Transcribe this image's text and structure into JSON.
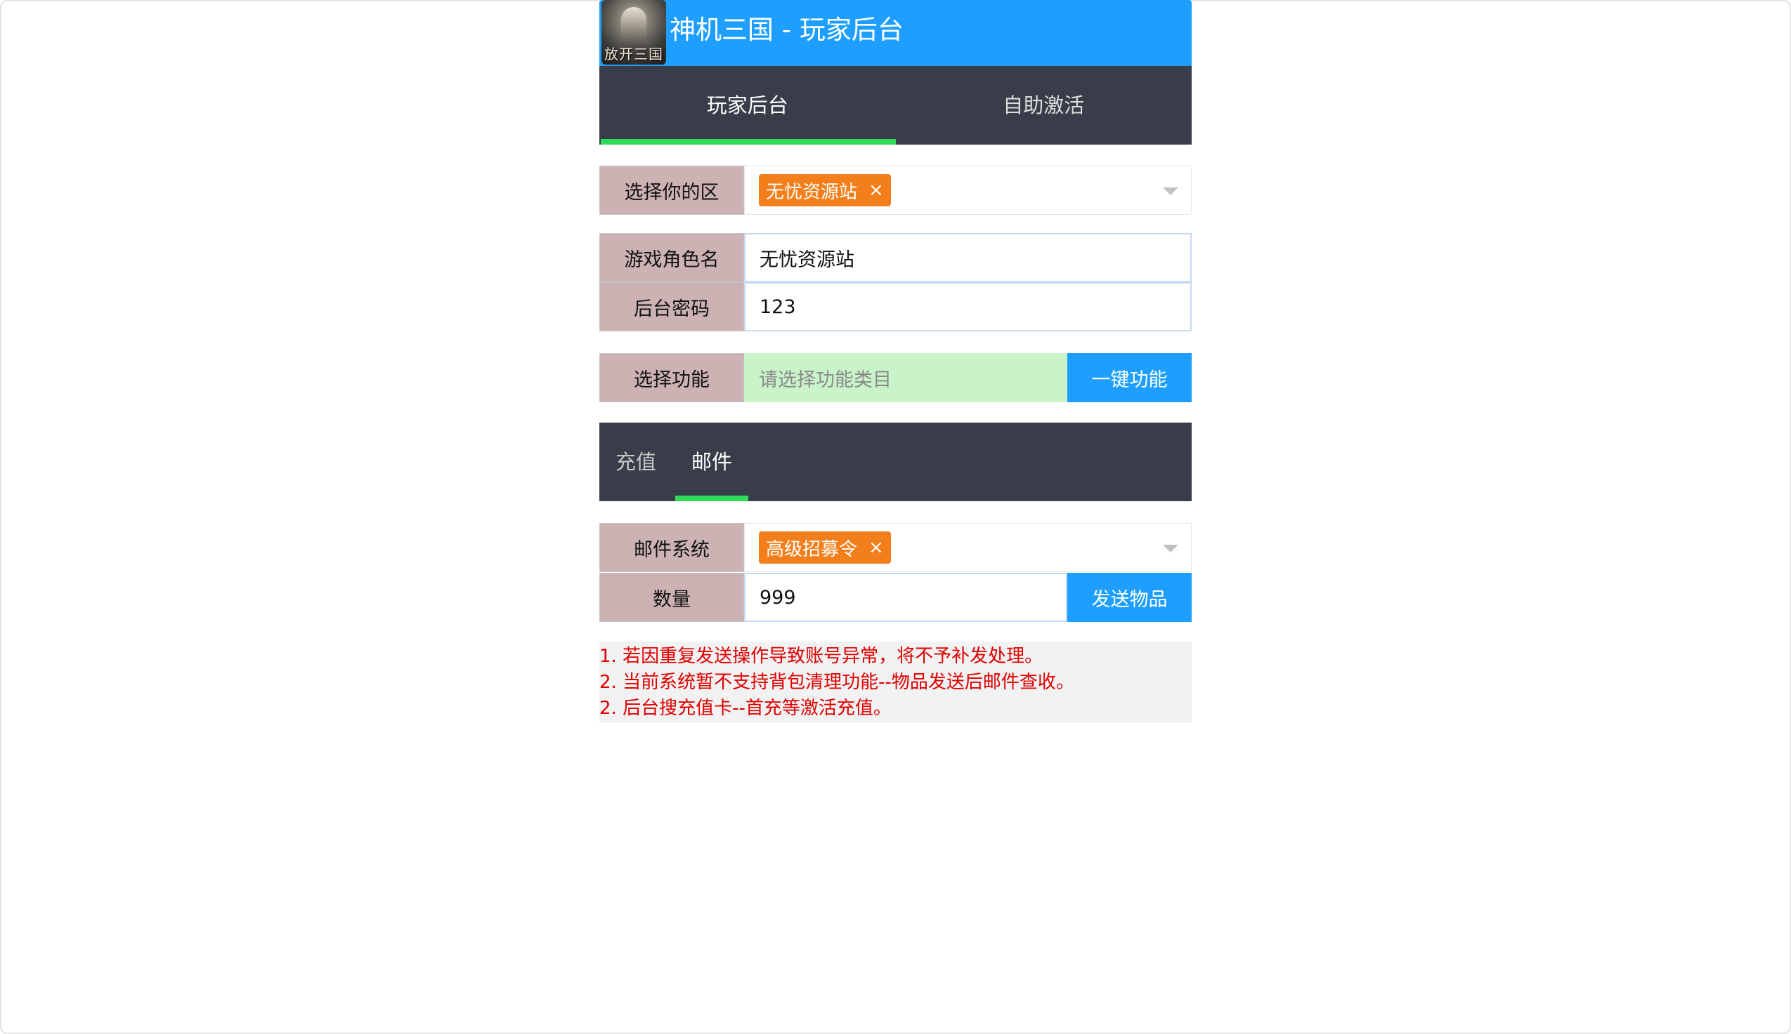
{
  "header": {
    "title": "神机三国 - 玩家后台",
    "logo_text": "放开三国",
    "color": "#1e9fff"
  },
  "main_tabs": [
    {
      "label": "玩家后台",
      "active": true
    },
    {
      "label": "自助激活",
      "active": false
    }
  ],
  "form": {
    "server": {
      "label": "选择你的区",
      "selected_tag": "无忧资源站",
      "remove_icon": "×"
    },
    "role_name": {
      "label": "游戏角色名",
      "value": "无忧资源站"
    },
    "password": {
      "label": "后台密码",
      "value": "123"
    },
    "function": {
      "label": "选择功能",
      "placeholder": "请选择功能类目",
      "button": "一键功能"
    }
  },
  "sub_tabs": [
    {
      "label": "充值",
      "active": false
    },
    {
      "label": "邮件",
      "active": true
    }
  ],
  "mail": {
    "system": {
      "label": "邮件系统",
      "selected_tag": "高级招募令",
      "remove_icon": "×"
    },
    "quantity": {
      "label": "数量",
      "value": "999",
      "button": "发送物品"
    }
  },
  "notes": [
    "1. 若因重复发送操作导致账号异常，将不予补发处理。",
    "2. 当前系统暂不支持背包清理功能--物品发送后邮件查收。",
    "2. 后台搜充值卡--首充等激活充值。"
  ],
  "colors": {
    "accent": "#1e9fff",
    "tab_bar": "#393d49",
    "tab_indicator": "#2fdc5a",
    "label_bg": "#cdb2b3",
    "tag_bg": "#f27f1b",
    "notes_text": "#e00000"
  }
}
